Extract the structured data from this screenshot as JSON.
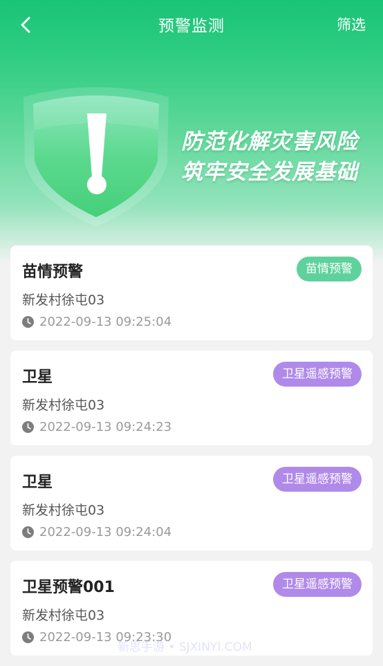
{
  "nav": {
    "title": "预警监测",
    "filter_label": "筛选"
  },
  "banner": {
    "line1": "防范化解灾害风险",
    "line2": "筑牢安全发展基础"
  },
  "colors": {
    "primary_green": "#19c477",
    "tag_seedling": "#5fd19c",
    "tag_satellite": "#b08ae9"
  },
  "alerts": [
    {
      "title": "苗情预警",
      "tag": "苗情预警",
      "tag_color": "#5fd19c",
      "location": "新发村徐屯03",
      "time": "2022-09-13 09:25:04"
    },
    {
      "title": "卫星",
      "tag": "卫星遥感预警",
      "tag_color": "#b08ae9",
      "location": "新发村徐屯03",
      "time": "2022-09-13 09:24:23"
    },
    {
      "title": "卫星",
      "tag": "卫星遥感预警",
      "tag_color": "#b08ae9",
      "location": "新发村徐屯03",
      "time": "2022-09-13 09:24:04"
    },
    {
      "title": "卫星预警001",
      "tag": "卫星遥感预警",
      "tag_color": "#b08ae9",
      "location": "新发村徐屯03",
      "time": "2022-09-13 09:23:30"
    }
  ],
  "watermark": "新思手游 • SJXINYI.COM"
}
